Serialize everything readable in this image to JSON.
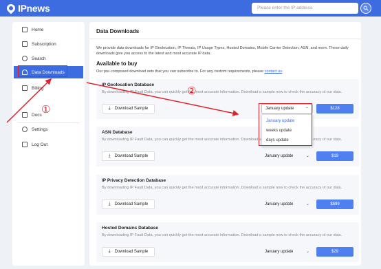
{
  "header": {
    "logo_text": "IPnews",
    "search_placeholder": "Please enter the IP address",
    "accent_color": "#3d6be0"
  },
  "sidebar": {
    "items": [
      {
        "label": "Home",
        "icon": "home-icon"
      },
      {
        "label": "Subscription",
        "icon": "subscription-icon"
      },
      {
        "label": "Search",
        "icon": "search-icon"
      },
      {
        "label": "Data Downloads",
        "icon": "cloud-download-icon",
        "active": true
      },
      {
        "label": "Billing",
        "icon": "billing-icon"
      },
      {
        "label": "Docs",
        "icon": "docs-icon"
      },
      {
        "label": "Settings",
        "icon": "gear-icon"
      },
      {
        "label": "Log Out",
        "icon": "logout-icon"
      }
    ]
  },
  "main": {
    "title": "Data Downloads",
    "intro": "We provide data downloads for IP Geolocation, IP Threats, IP Usage Types, Hosted Domains, Mobile Carrier Detection, ASN, and more. These daily downloads give you access to the latest and most accurate IP data.",
    "available_title": "Available to buy",
    "available_desc": "Our pre-composed download sets that you can subscribe to. For any custom requirements, please",
    "contact_link": "contact us",
    "contact_suffix": ".",
    "cards": [
      {
        "title": "IP Geolocation Database",
        "desc": "By downloading IP Fault Data, you can quickly get the most accurate information. Download a sample now to check the accuracy of our data.",
        "sample_label": "Download Sample",
        "update": "January update",
        "price": "$128"
      },
      {
        "title": "ASN Database",
        "desc": "By downloading IP Fault Data, you can quickly get the most accurate information. Download a sample now to check the accuracy of our data.",
        "sample_label": "Download Sample",
        "update": "January update",
        "price": "$19"
      },
      {
        "title": "IP Privacy Detection Database",
        "desc": "By downloading IP Fault Data, you can quickly get the most accurate information. Download a sample now to check the accuracy of our data.",
        "sample_label": "Download Sample",
        "update": "January update",
        "price": "$899"
      },
      {
        "title": "Hosted Domains Database",
        "desc": "By downloading IP Fault Data, you can quickly get the most accurate information. Download a sample now to check the accuracy of our data.",
        "sample_label": "Download Sample",
        "update": "January update",
        "price": "$29"
      }
    ],
    "dropdown_options": [
      "January update",
      "weeks update",
      "days update"
    ]
  },
  "annotations": {
    "marker_1": "①",
    "marker_2": "②",
    "color": "#e0212b"
  }
}
